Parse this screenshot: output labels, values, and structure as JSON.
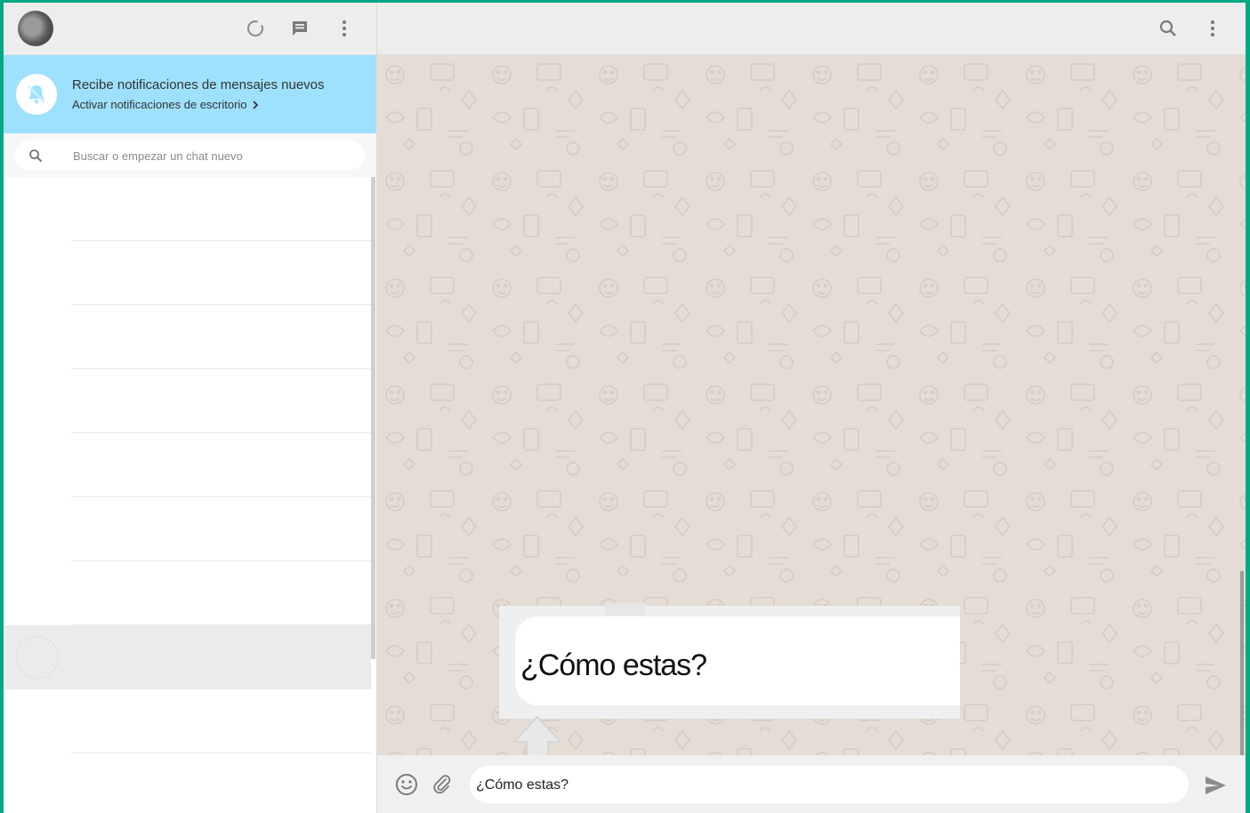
{
  "colors": {
    "accent": "#00a884",
    "notification_bg": "#9de1fe",
    "header_bg": "#ededed",
    "chat_bg": "#e5ddd5"
  },
  "sidebar_header": {
    "icons": [
      "status-icon",
      "new-chat-icon",
      "menu-icon"
    ]
  },
  "notification": {
    "title": "Recibe notificaciones de mensajes nuevos",
    "link": "Activar notificaciones de escritorio",
    "link_icon": "chevron-right-icon",
    "icon": "bell-off-icon"
  },
  "search": {
    "placeholder": "Buscar o empezar un chat nuevo",
    "icon": "search-icon"
  },
  "chat_header": {
    "icons": [
      "search-icon",
      "menu-icon"
    ]
  },
  "callout": {
    "text": "¿Cómo estas?"
  },
  "composer": {
    "value": "¿Cómo estas?",
    "icons": [
      "emoji-icon",
      "attach-icon",
      "send-icon"
    ]
  }
}
